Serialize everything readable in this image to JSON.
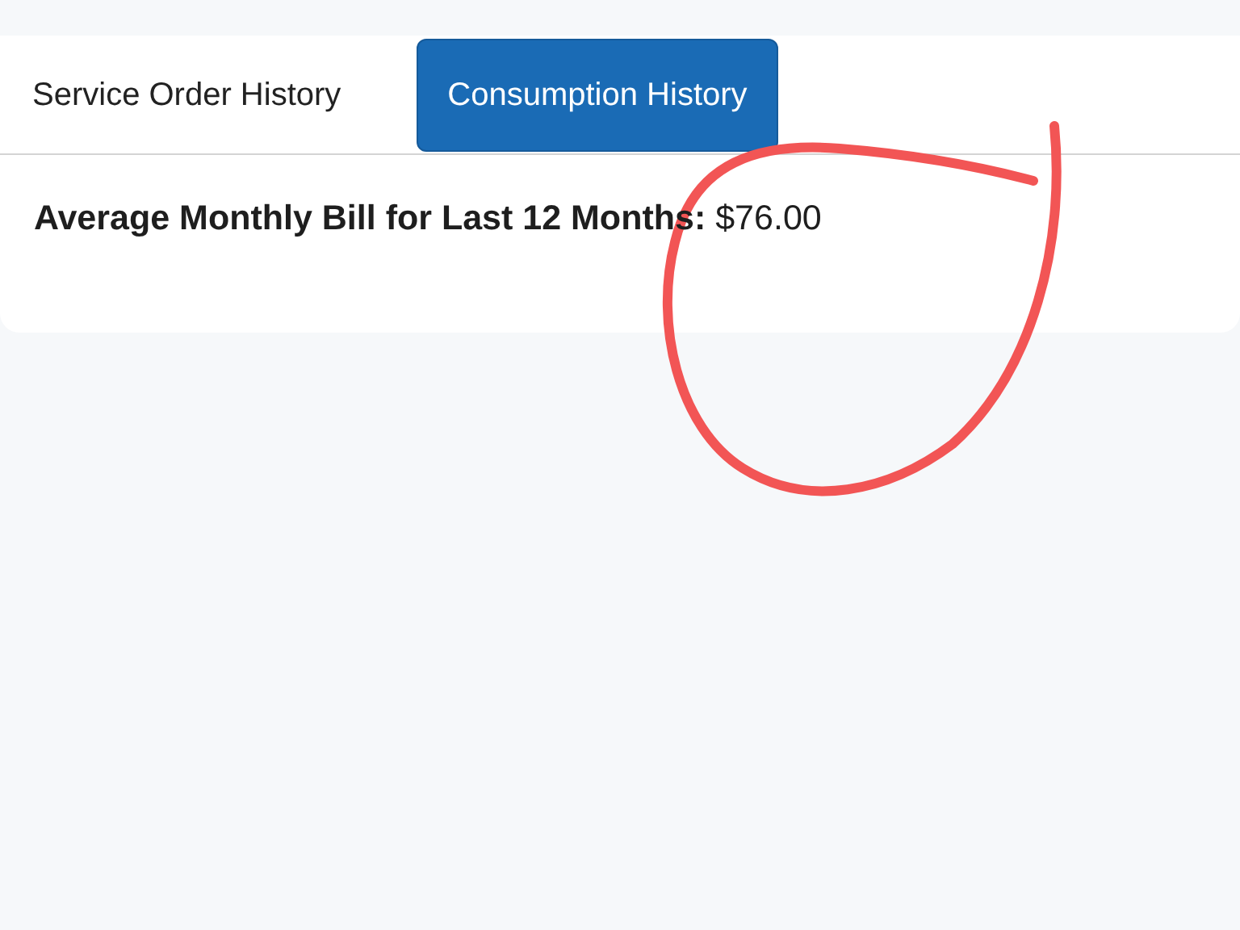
{
  "tabs": [
    {
      "label": "Service Order History",
      "selected": false
    },
    {
      "label": "Consumption History",
      "selected": true
    }
  ],
  "summary": {
    "text": "**Average Monthly Bill for Last 12 Months:** $76.00"
  }
}
